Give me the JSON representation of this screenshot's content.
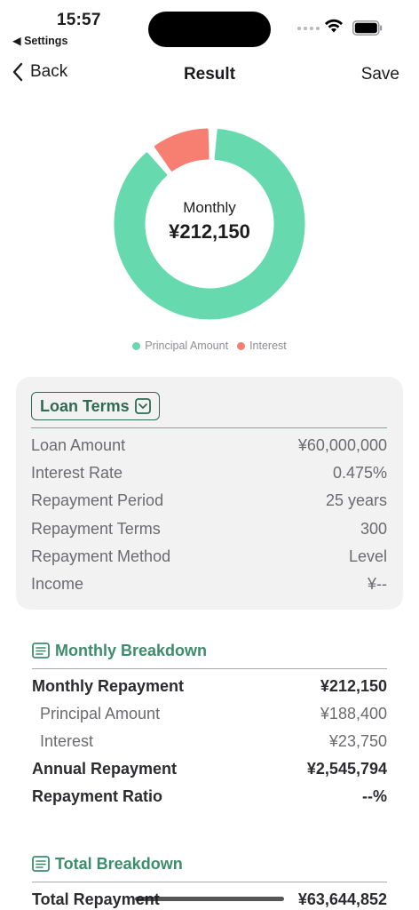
{
  "status_bar": {
    "time": "15:57",
    "back_app": "◀ Settings"
  },
  "nav": {
    "back_label": "Back",
    "title": "Result",
    "save_label": "Save"
  },
  "chart_data": {
    "type": "pie",
    "categories": [
      "Principal Amount",
      "Interest"
    ],
    "values": [
      188400,
      23750
    ],
    "colors": [
      "#67d9af",
      "#f77f72"
    ],
    "center_label": "Monthly",
    "center_value": "¥212,150",
    "legend_position": "bottom"
  },
  "legend": {
    "principal": "Principal Amount",
    "interest": "Interest"
  },
  "loan_terms": {
    "chip_label": "Loan Terms",
    "rows": [
      {
        "label": "Loan Amount",
        "value": "¥60,000,000"
      },
      {
        "label": "Interest Rate",
        "value": "0.475%"
      },
      {
        "label": "Repayment Period",
        "value": "25 years"
      },
      {
        "label": "Repayment Terms",
        "value": "300"
      },
      {
        "label": "Repayment Method",
        "value": "Level"
      },
      {
        "label": "Income",
        "value": "¥--"
      }
    ]
  },
  "monthly_breakdown": {
    "title": "Monthly Breakdown",
    "monthly_repayment_label": "Monthly Repayment",
    "monthly_repayment_value": "¥212,150",
    "principal_label": "Principal Amount",
    "principal_value": "¥188,400",
    "interest_label": "Interest",
    "interest_value": "¥23,750",
    "annual_label": "Annual Repayment",
    "annual_value": "¥2,545,794",
    "ratio_label": "Repayment Ratio",
    "ratio_value": "--%"
  },
  "total_breakdown": {
    "title": "Total Breakdown",
    "total_label": "Total Repayment",
    "total_value": "¥63,644,852"
  },
  "colors": {
    "principal": "#67d9af",
    "interest": "#f77f72",
    "accent_green": "#3d8c6c",
    "dark_green": "#2f6b52"
  }
}
